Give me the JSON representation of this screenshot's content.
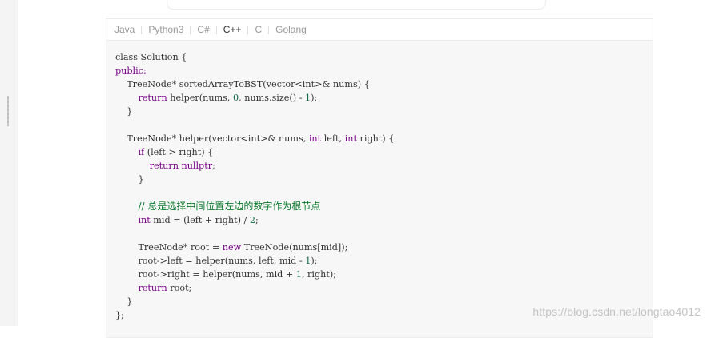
{
  "tabs": [
    {
      "label": "Java",
      "active": false
    },
    {
      "label": "Python3",
      "active": false
    },
    {
      "label": "C#",
      "active": false
    },
    {
      "label": "C++",
      "active": true
    },
    {
      "label": "C",
      "active": false
    },
    {
      "label": "Golang",
      "active": false
    }
  ],
  "code_lines": [
    [
      {
        "t": "class Solution {",
        "c": ""
      }
    ],
    [
      {
        "t": "public:",
        "c": "kw"
      }
    ],
    [
      {
        "t": "    TreeNode* ",
        "c": ""
      },
      {
        "t": "sortedArrayToBST",
        "c": ""
      },
      {
        "t": "(vector<int>& nums) {",
        "c": ""
      }
    ],
    [
      {
        "t": "        ",
        "c": ""
      },
      {
        "t": "return",
        "c": "kw"
      },
      {
        "t": " helper(nums, ",
        "c": ""
      },
      {
        "t": "0",
        "c": "num"
      },
      {
        "t": ", nums.size() - ",
        "c": ""
      },
      {
        "t": "1",
        "c": "num"
      },
      {
        "t": ");",
        "c": ""
      }
    ],
    [
      {
        "t": "    }",
        "c": ""
      }
    ],
    [
      {
        "t": "",
        "c": ""
      }
    ],
    [
      {
        "t": "    TreeNode* ",
        "c": ""
      },
      {
        "t": "helper",
        "c": ""
      },
      {
        "t": "(vector<int>& nums, ",
        "c": ""
      },
      {
        "t": "int",
        "c": "kw"
      },
      {
        "t": " left, ",
        "c": ""
      },
      {
        "t": "int",
        "c": "kw"
      },
      {
        "t": " right) {",
        "c": ""
      }
    ],
    [
      {
        "t": "        ",
        "c": ""
      },
      {
        "t": "if",
        "c": "kw"
      },
      {
        "t": " (left > right) {",
        "c": ""
      }
    ],
    [
      {
        "t": "            ",
        "c": ""
      },
      {
        "t": "return",
        "c": "kw"
      },
      {
        "t": " ",
        "c": ""
      },
      {
        "t": "nullptr",
        "c": "kw"
      },
      {
        "t": ";",
        "c": ""
      }
    ],
    [
      {
        "t": "        }",
        "c": ""
      }
    ],
    [
      {
        "t": "",
        "c": ""
      }
    ],
    [
      {
        "t": "        ",
        "c": ""
      },
      {
        "t": "// 总是选择中间位置左边的数字作为根节点",
        "c": "cm"
      }
    ],
    [
      {
        "t": "        ",
        "c": ""
      },
      {
        "t": "int",
        "c": "kw"
      },
      {
        "t": " mid = (left + right) / ",
        "c": ""
      },
      {
        "t": "2",
        "c": "num"
      },
      {
        "t": ";",
        "c": ""
      }
    ],
    [
      {
        "t": "",
        "c": ""
      }
    ],
    [
      {
        "t": "        TreeNode* root = ",
        "c": ""
      },
      {
        "t": "new",
        "c": "kw"
      },
      {
        "t": " TreeNode(nums[mid]);",
        "c": ""
      }
    ],
    [
      {
        "t": "        root->left = helper(nums, left, mid - ",
        "c": ""
      },
      {
        "t": "1",
        "c": "num"
      },
      {
        "t": ");",
        "c": ""
      }
    ],
    [
      {
        "t": "        root->right = helper(nums, mid + ",
        "c": ""
      },
      {
        "t": "1",
        "c": "num"
      },
      {
        "t": ", right);",
        "c": ""
      }
    ],
    [
      {
        "t": "        ",
        "c": ""
      },
      {
        "t": "return",
        "c": "kw"
      },
      {
        "t": " root;",
        "c": ""
      }
    ],
    [
      {
        "t": "    }",
        "c": ""
      }
    ],
    [
      {
        "t": "};",
        "c": ""
      }
    ]
  ],
  "watermark": "https://blog.csdn.net/longtao4012"
}
